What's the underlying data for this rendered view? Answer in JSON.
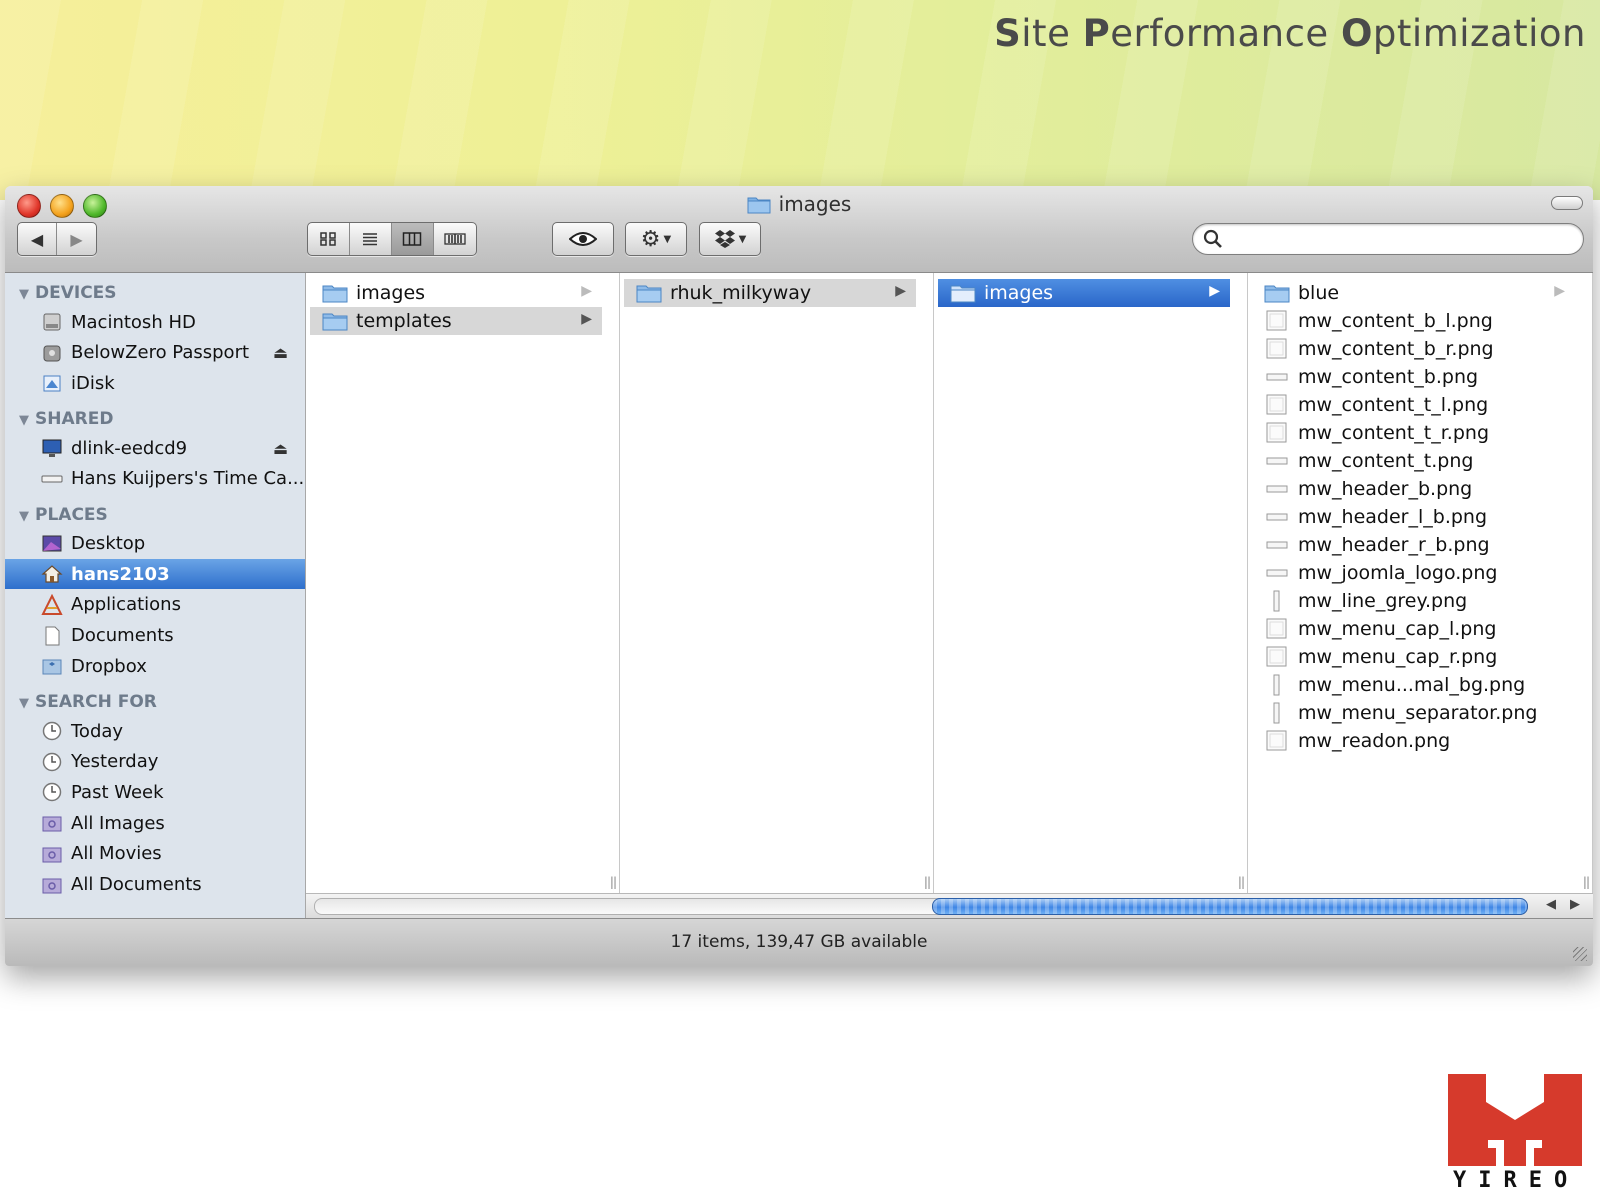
{
  "banner": {
    "title_parts": [
      {
        "cap": "S",
        "rest": "ite "
      },
      {
        "cap": "P",
        "rest": "erformance "
      },
      {
        "cap": "O",
        "rest": "ptimization"
      }
    ]
  },
  "window": {
    "title": "images",
    "status": "17 items, 139,47 GB available",
    "search": {
      "value": "",
      "placeholder": ""
    }
  },
  "sidebar": {
    "sections": [
      {
        "header": "DEVICES",
        "items": [
          {
            "label": "Macintosh HD",
            "icon": "hard-drive-icon",
            "eject": false,
            "selected": false
          },
          {
            "label": "BelowZero Passport",
            "icon": "external-drive-icon",
            "eject": true,
            "selected": false
          },
          {
            "label": "iDisk",
            "icon": "idisk-icon",
            "eject": false,
            "selected": false
          }
        ]
      },
      {
        "header": "SHARED",
        "items": [
          {
            "label": "dlink-eedcd9",
            "icon": "network-computer-icon",
            "eject": true,
            "selected": false
          },
          {
            "label": "Hans Kuijpers's Time Ca...",
            "icon": "time-capsule-icon",
            "eject": false,
            "selected": false
          }
        ]
      },
      {
        "header": "PLACES",
        "items": [
          {
            "label": "Desktop",
            "icon": "desktop-icon",
            "eject": false,
            "selected": false
          },
          {
            "label": "hans2103",
            "icon": "home-icon",
            "eject": false,
            "selected": true
          },
          {
            "label": "Applications",
            "icon": "applications-icon",
            "eject": false,
            "selected": false
          },
          {
            "label": "Documents",
            "icon": "documents-icon",
            "eject": false,
            "selected": false
          },
          {
            "label": "Dropbox",
            "icon": "dropbox-folder-icon",
            "eject": false,
            "selected": false
          }
        ]
      },
      {
        "header": "SEARCH FOR",
        "items": [
          {
            "label": "Today",
            "icon": "clock-icon",
            "eject": false,
            "selected": false
          },
          {
            "label": "Yesterday",
            "icon": "clock-icon",
            "eject": false,
            "selected": false
          },
          {
            "label": "Past Week",
            "icon": "clock-icon",
            "eject": false,
            "selected": false
          },
          {
            "label": "All Images",
            "icon": "smart-folder-icon",
            "eject": false,
            "selected": false
          },
          {
            "label": "All Movies",
            "icon": "smart-folder-icon",
            "eject": false,
            "selected": false
          },
          {
            "label": "All Documents",
            "icon": "smart-folder-icon",
            "eject": false,
            "selected": false
          }
        ]
      }
    ]
  },
  "columns": [
    {
      "items": [
        {
          "label": "images",
          "type": "folder",
          "state": "none"
        },
        {
          "label": "templates",
          "type": "folder",
          "state": "gray"
        }
      ]
    },
    {
      "items": [
        {
          "label": "rhuk_milkyway",
          "type": "folder",
          "state": "gray"
        }
      ]
    },
    {
      "items": [
        {
          "label": "images",
          "type": "folder",
          "state": "blue"
        }
      ]
    },
    {
      "items": [
        {
          "label": "blue",
          "type": "folder",
          "state": "none"
        },
        {
          "label": "mw_content_b_l.png",
          "type": "file",
          "state": "none"
        },
        {
          "label": "mw_content_b_r.png",
          "type": "file",
          "state": "none"
        },
        {
          "label": "mw_content_b.png",
          "type": "file-wide",
          "state": "none"
        },
        {
          "label": "mw_content_t_l.png",
          "type": "file",
          "state": "none"
        },
        {
          "label": "mw_content_t_r.png",
          "type": "file",
          "state": "none"
        },
        {
          "label": "mw_content_t.png",
          "type": "file-wide",
          "state": "none"
        },
        {
          "label": "mw_header_b.png",
          "type": "file-wide",
          "state": "none"
        },
        {
          "label": "mw_header_l_b.png",
          "type": "file-wide",
          "state": "none"
        },
        {
          "label": "mw_header_r_b.png",
          "type": "file-wide",
          "state": "none"
        },
        {
          "label": "mw_joomla_logo.png",
          "type": "file-wide",
          "state": "none"
        },
        {
          "label": "mw_line_grey.png",
          "type": "file-tall",
          "state": "none"
        },
        {
          "label": "mw_menu_cap_l.png",
          "type": "file",
          "state": "none"
        },
        {
          "label": "mw_menu_cap_r.png",
          "type": "file",
          "state": "none"
        },
        {
          "label": "mw_menu...mal_bg.png",
          "type": "file-tall",
          "state": "none"
        },
        {
          "label": "mw_menu_separator.png",
          "type": "file-tall",
          "state": "none"
        },
        {
          "label": "mw_readon.png",
          "type": "file",
          "state": "none"
        }
      ]
    }
  ],
  "scroll": {
    "position_fraction": 0.51,
    "visible_fraction": 0.49
  },
  "logo": {
    "text": "YIREO",
    "color": "#d63a2c"
  },
  "colors": {
    "selection_blue": "#2e6fcc",
    "sidebar_bg": "#dde4ec"
  }
}
